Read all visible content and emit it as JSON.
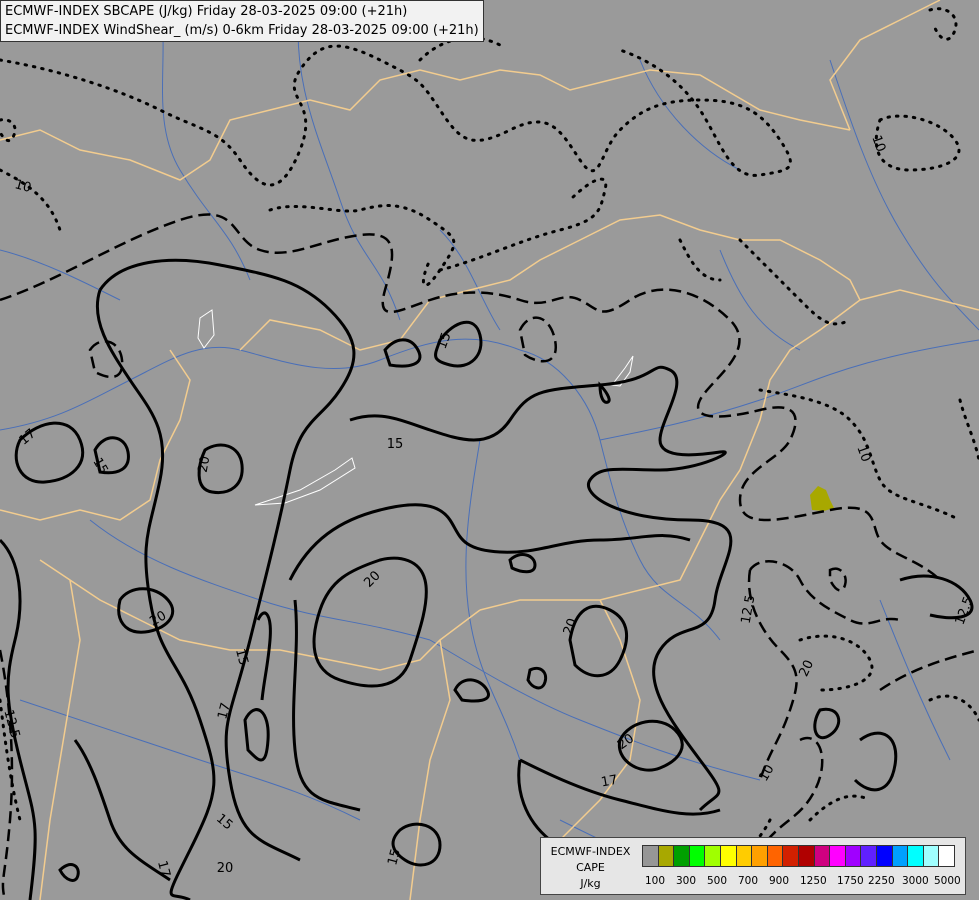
{
  "title": {
    "line1": "ECMWF-INDEX SBCAPE (J/kg) Friday 28-03-2025 09:00 (+21h)",
    "line2": "ECMWF-INDEX WindShear_ (m/s) 0-6km Friday 28-03-2025 09:00 (+21h)"
  },
  "legend": {
    "model": "ECMWF-INDEX",
    "field": "CAPE",
    "unit": "J/kg",
    "colors": [
      "#969696",
      "#a8a800",
      "#00a000",
      "#00ff00",
      "#a0ff00",
      "#ffff00",
      "#ffcc00",
      "#ffa000",
      "#ff6400",
      "#d22000",
      "#b00000",
      "#d00080",
      "#ff00ff",
      "#a000ff",
      "#6020ff",
      "#0000ff",
      "#00a0ff",
      "#00ffff",
      "#a0ffff",
      "#ffffff"
    ],
    "tick_labels": [
      "100",
      "300",
      "500",
      "700",
      "900",
      "1250",
      "1750",
      "2250",
      "3000",
      "5000"
    ]
  },
  "contour_labels": {
    "shear": [
      "10",
      "10",
      "10",
      "10",
      "12.5",
      "12.5",
      "12.5",
      "15",
      "15",
      "15",
      "15",
      "15",
      "15",
      "17",
      "17",
      "17",
      "17",
      "20",
      "20",
      "20",
      "20",
      "20",
      "20",
      "20"
    ]
  },
  "colors": {
    "background": "#9a9a9a",
    "borders": "#f2cc8f",
    "rivers": "#4a6fb8",
    "contours": "#000000",
    "cape_patch": "#a8a800"
  }
}
